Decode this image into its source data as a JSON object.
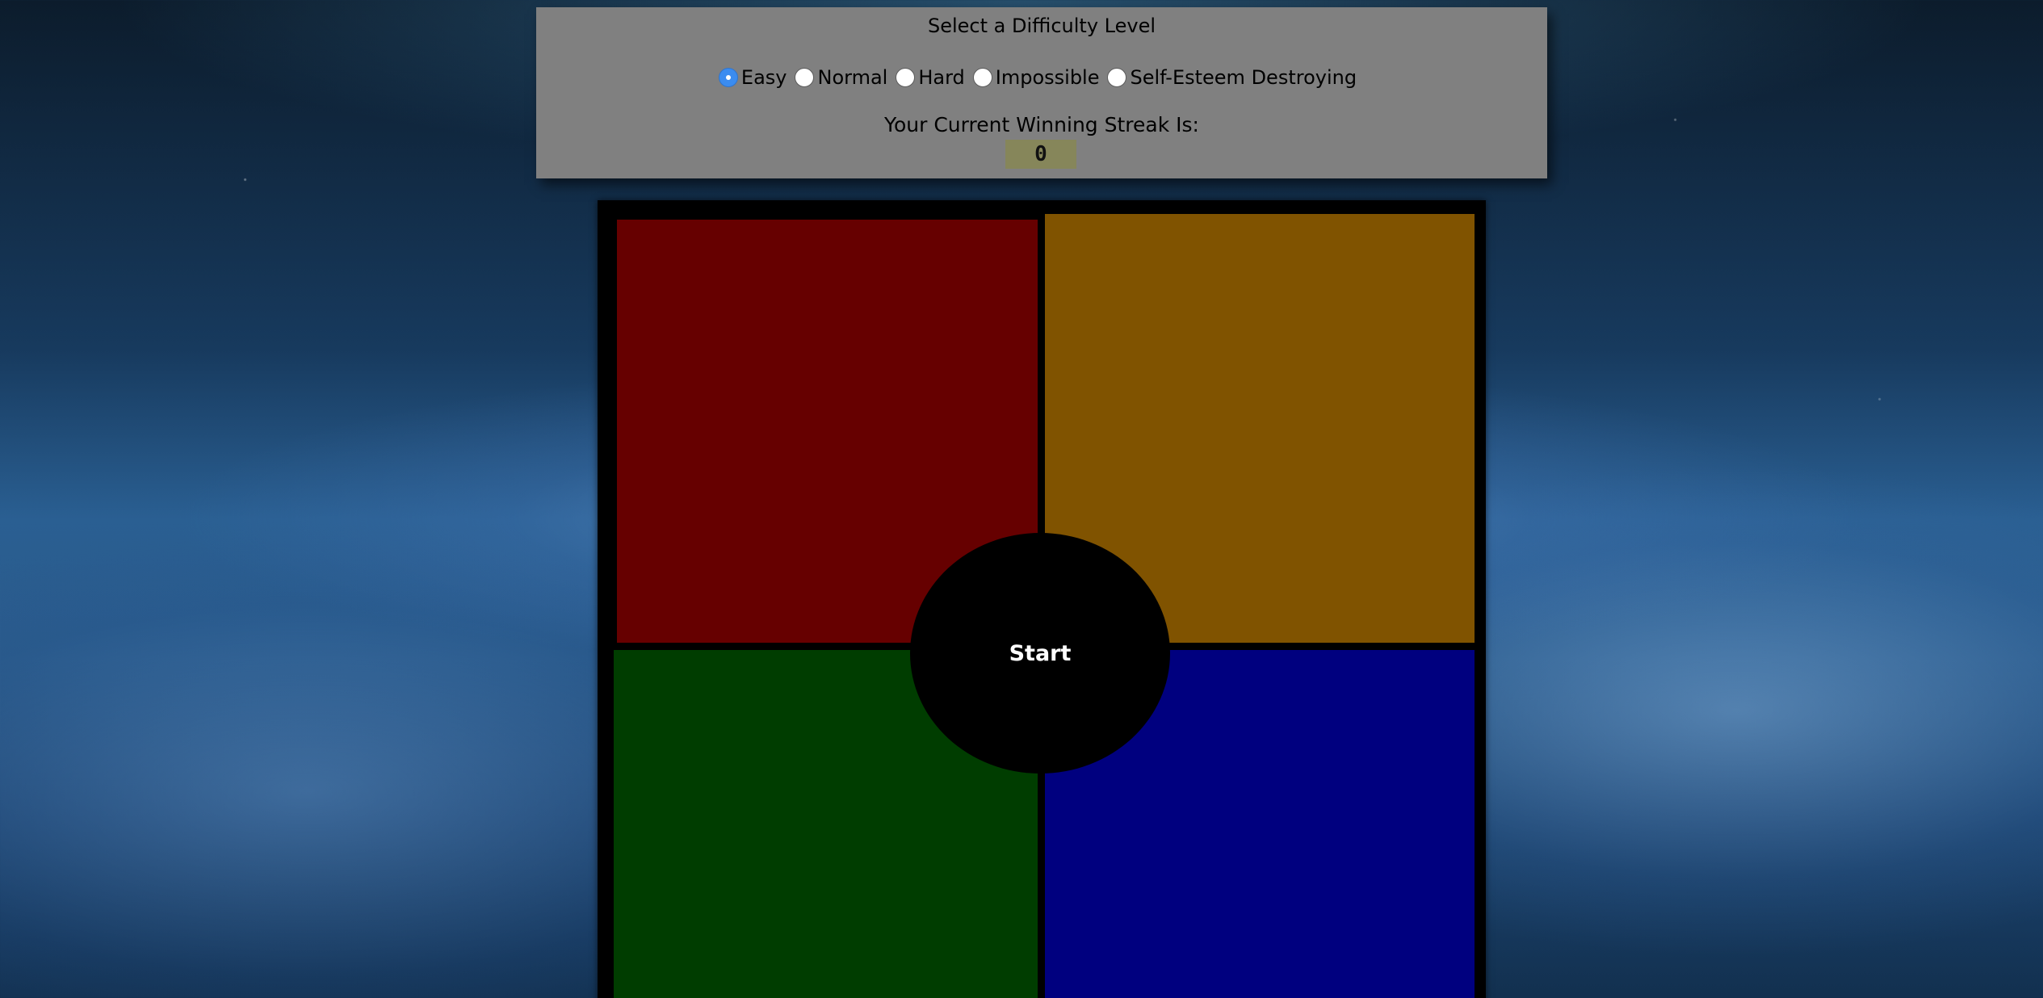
{
  "panel": {
    "title": "Select a Difficulty Level",
    "difficulty_options": [
      {
        "label": "Easy",
        "checked": true
      },
      {
        "label": "Normal",
        "checked": false
      },
      {
        "label": "Hard",
        "checked": false
      },
      {
        "label": "Impossible",
        "checked": false
      },
      {
        "label": "Self-Esteem Destroying",
        "checked": false
      }
    ],
    "streak_label": "Your Current Winning Streak Is:",
    "streak_value": "0"
  },
  "board": {
    "start_label": "Start",
    "colors": {
      "red": "#660000",
      "yellow": "#805300",
      "green": "#003d00",
      "blue": "#00007f",
      "frame": "#000000",
      "panel": "#808080",
      "streak_box": "#86865a",
      "radio_selected": "#3b8cf0"
    }
  }
}
